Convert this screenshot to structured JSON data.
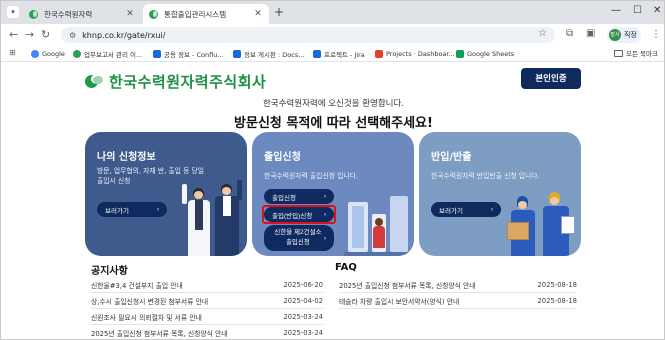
{
  "browser": {
    "tabs": [
      {
        "label": "한국수력원자력",
        "active": false
      },
      {
        "label": "통합출입관리시스템",
        "active": true
      }
    ],
    "url": "khnp.co.kr/gate/rxui/",
    "profile_label": "직장",
    "profile_initials": "발사",
    "bookmarks": [
      {
        "label": "Google",
        "color": "#4285f4"
      },
      {
        "label": "업무보고서 관리 이...",
        "color": "#2f9e56"
      },
      {
        "label": "공용 정보 - Conflu...",
        "color": "#1868db"
      },
      {
        "label": "정보 게시판 : Docs...",
        "color": "#1868db"
      },
      {
        "label": "프로젝트 - Jira",
        "color": "#1868db"
      },
      {
        "label": "Projects · Dashboar...",
        "color": "#e24329"
      },
      {
        "label": "Google Sheets",
        "color": "#0f9d58"
      }
    ],
    "all_bookmarks_label": "모든 북마크"
  },
  "header": {
    "logo_text": "한국수력원자력주식회사",
    "auth_button": "본인인증",
    "welcome": "한국수력원자력에 오신것을 환영합니다.",
    "headline": "방문신청 목적에 따라 선택해주세요!"
  },
  "cards": {
    "my_request": {
      "title": "나의 신청정보",
      "desc": "방문, 업무협의, 자재 반, 출입 등 당일 출입시 신청",
      "button": "보러가기",
      "color": "#3f5a8c"
    },
    "entry": {
      "title": "출입신청",
      "desc": "한국수력원자력 출입신청 입니다.",
      "buttons": [
        "출입신청",
        "출입(반입)신청",
        "신한울 제2건설소 출입신청"
      ],
      "highlight_color": "#e0101a",
      "color": "#6d8ac0"
    },
    "carry": {
      "title": "반입/반출",
      "desc": "한국수력원자력 반입반출 신청 입니다.",
      "button": "보러가기",
      "color": "#7d9dc2"
    }
  },
  "notices": {
    "title": "공지사항",
    "items": [
      {
        "text": "신한울#3,4 건설부지 출입 안내",
        "date": "2025-06-20"
      },
      {
        "text": "상,수시 출입신청시 변경된 첨부서류 안내",
        "date": "2025-04-02"
      },
      {
        "text": "신원조사 필요시 의뢰절차 및 서류 안내",
        "date": "2025-03-24"
      },
      {
        "text": "2025년 출입신청 첨부서류 목록, 신청양식 안내",
        "date": "2025-03-24"
      }
    ]
  },
  "faq": {
    "title": "FAQ",
    "items": [
      {
        "text": "2025년 출입신청 첨부서류 목록, 신청양식 안내",
        "date": "2025-08-18"
      },
      {
        "text": "테슬라 차량 출입시 보안서약서(양식) 안내",
        "date": "2025-08-18"
      }
    ]
  },
  "colors": {
    "brand_green": "#1f8f45",
    "navy": "#0e2a5e"
  }
}
